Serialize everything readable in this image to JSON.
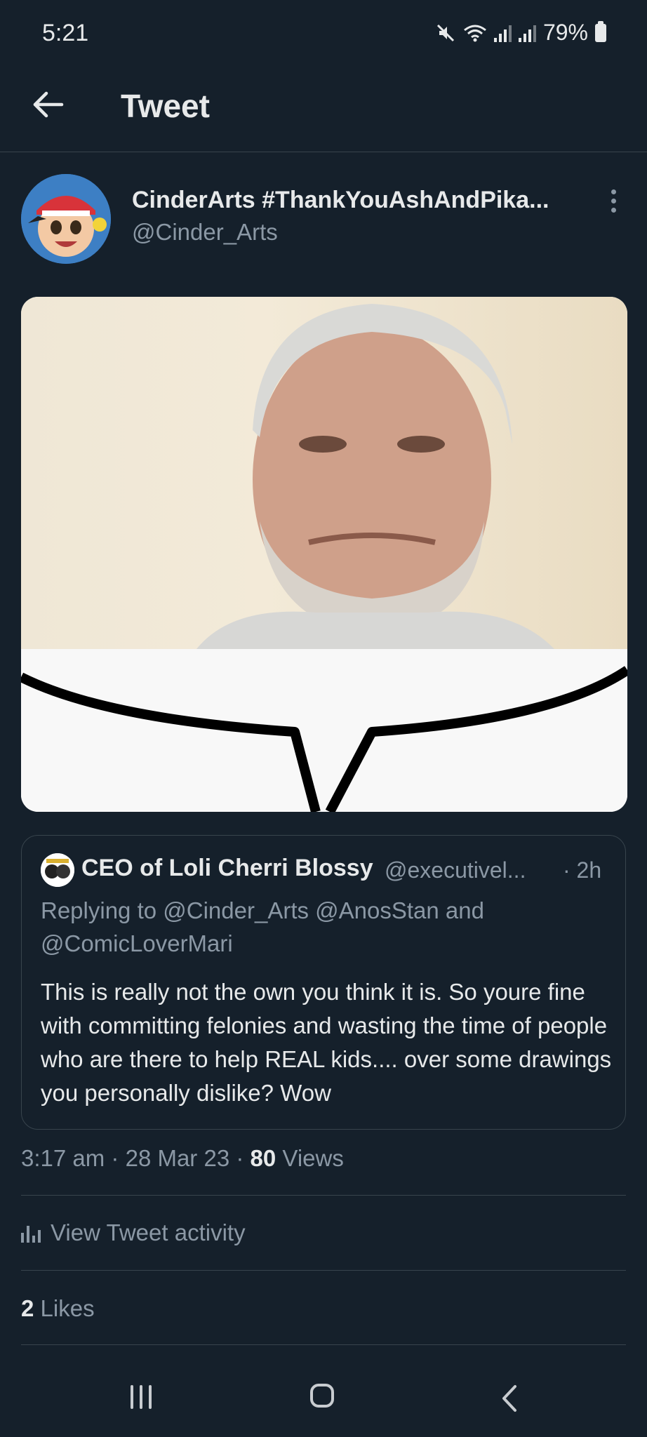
{
  "status_bar": {
    "time": "5:21",
    "battery": "79%",
    "icons": [
      "mute-icon",
      "wifi-icon",
      "signal-icon",
      "signal-icon",
      "battery-icon"
    ]
  },
  "header": {
    "title": "Tweet",
    "back_icon": "arrow-left-icon"
  },
  "tweet": {
    "display_name": "CinderArts #ThankYouAshAndPika...",
    "handle": "@Cinder_Arts",
    "more_icon": "more-vertical-icon",
    "media": {
      "top_part": "photo",
      "bottom_part": "speech bubble"
    },
    "timestamp": "3:17 am",
    "date": "28 Mar 23",
    "views_count": "80",
    "views_label": "Views",
    "separator": "·"
  },
  "quoted_tweet": {
    "display_name": "CEO of Loli Cherri Blossy",
    "handle": "@executivel...",
    "time": "· 2h",
    "reply_prefix": "Replying to ",
    "reply_line1": "@Cinder_Arts @AnosStan and",
    "reply_line2": "@ComicLoverMari",
    "body": "This is really not the own you think it is. So youre fine with committing felonies and wasting the time of people who are there to help REAL kids.... over some drawings you personally dislike? Wow"
  },
  "activity": {
    "icon": "bar-chart-icon",
    "label": "View Tweet activity"
  },
  "likes": {
    "count": "2",
    "label": "Likes"
  },
  "nav_bar": {
    "items": [
      "recents-icon",
      "home-icon",
      "back-icon"
    ]
  },
  "colors": {
    "background": "#15202b",
    "text": "#e7e9ea",
    "secondary": "#8b98a5",
    "border": "#38444d"
  }
}
